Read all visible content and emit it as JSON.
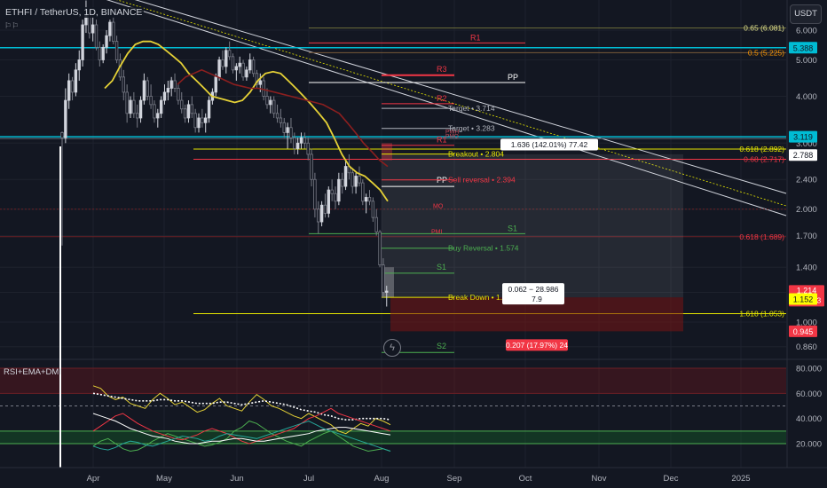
{
  "header": {
    "symbol_title": "ETHFI / TetherUS, 1D, BINANCE",
    "sub_icon": "flag-icon",
    "currency_button": "USDT",
    "indicator_label": "RSI+EMA+DMI"
  },
  "colors": {
    "background": "#131722",
    "grid": "#1e222d",
    "up": "#d1d4dc",
    "down": "#787b86",
    "ema": "#e5d136",
    "ema_red": "#8b1f1f",
    "cyan": "#00bcd4",
    "red": "#f23645",
    "green": "#4caf50",
    "yellow": "#e6e600",
    "white": "#ffffff",
    "orange": "#ff9800"
  },
  "chart_data": [
    {
      "type": "candlestick",
      "title": "ETHFI / TetherUS, 1D, BINANCE",
      "y_scale": "log",
      "ylim": [
        0.8,
        6.6
      ],
      "x_ticks": [
        "Apr",
        "May",
        "Jun",
        "Jul",
        "Aug",
        "Sep",
        "Oct",
        "Nov",
        "Dec",
        "2025"
      ],
      "y_ticks": [
        "6.000",
        "5.000",
        "4.000",
        "3.000",
        "2.400",
        "2.000",
        "1.700",
        "1.400",
        "1.200",
        "1.000",
        "0.860"
      ],
      "series": [
        {
          "name": "candles",
          "ohlc": [
            [
              3.2,
              3.22,
              1.6,
              3.1
            ],
            [
              3.1,
              4.2,
              3.0,
              3.9
            ],
            [
              3.9,
              4.6,
              3.7,
              4.4
            ],
            [
              4.4,
              4.5,
              3.9,
              4.1
            ],
            [
              4.1,
              4.9,
              4.0,
              4.7
            ],
            [
              4.7,
              5.3,
              4.4,
              5.0
            ],
            [
              5.0,
              6.4,
              4.8,
              6.2
            ],
            [
              6.2,
              7.2,
              5.9,
              6.6
            ],
            [
              6.6,
              6.8,
              5.7,
              5.9
            ],
            [
              5.9,
              6.5,
              5.6,
              6.2
            ],
            [
              6.2,
              6.4,
              5.3,
              5.4
            ],
            [
              5.4,
              5.6,
              4.8,
              5.0
            ],
            [
              5.0,
              5.5,
              4.9,
              5.4
            ],
            [
              5.4,
              6.0,
              5.2,
              5.8
            ],
            [
              5.8,
              6.4,
              5.6,
              6.3
            ],
            [
              6.3,
              6.5,
              5.5,
              5.6
            ],
            [
              5.6,
              5.8,
              4.9,
              5.0
            ],
            [
              5.0,
              5.2,
              4.4,
              4.5
            ],
            [
              4.5,
              4.7,
              3.9,
              4.1
            ],
            [
              4.1,
              4.3,
              3.4,
              3.6
            ],
            [
              3.6,
              4.0,
              3.5,
              3.9
            ],
            [
              3.9,
              4.1,
              3.5,
              3.6
            ],
            [
              3.6,
              3.8,
              3.3,
              3.5
            ],
            [
              3.5,
              4.0,
              3.4,
              3.9
            ],
            [
              3.9,
              4.6,
              3.8,
              4.4
            ],
            [
              4.4,
              4.5,
              3.9,
              4.0
            ],
            [
              4.0,
              4.3,
              3.7,
              3.8
            ],
            [
              3.8,
              3.9,
              3.4,
              3.5
            ],
            [
              3.5,
              3.7,
              3.3,
              3.6
            ],
            [
              3.6,
              4.0,
              3.5,
              3.9
            ],
            [
              3.9,
              4.3,
              3.8,
              4.1
            ],
            [
              4.1,
              4.4,
              3.9,
              4.2
            ],
            [
              4.2,
              4.5,
              4.0,
              4.4
            ],
            [
              4.4,
              4.6,
              4.1,
              4.2
            ],
            [
              4.2,
              4.3,
              3.8,
              3.9
            ],
            [
              3.9,
              4.1,
              3.6,
              3.7
            ],
            [
              3.7,
              3.8,
              3.4,
              3.5
            ],
            [
              3.5,
              3.9,
              3.4,
              3.8
            ],
            [
              3.8,
              4.0,
              3.5,
              3.6
            ],
            [
              3.6,
              3.7,
              3.2,
              3.3
            ],
            [
              3.3,
              3.6,
              3.2,
              3.5
            ],
            [
              3.5,
              3.7,
              3.3,
              3.4
            ],
            [
              3.4,
              3.6,
              3.2,
              3.5
            ],
            [
              3.5,
              4.0,
              3.4,
              3.9
            ],
            [
              3.9,
              4.2,
              3.8,
              4.1
            ],
            [
              4.1,
              4.6,
              4.0,
              4.5
            ],
            [
              4.5,
              5.1,
              4.4,
              5.0
            ],
            [
              5.0,
              5.3,
              4.7,
              4.8
            ],
            [
              4.8,
              5.4,
              4.6,
              5.3
            ],
            [
              5.3,
              5.6,
              5.0,
              5.1
            ],
            [
              5.1,
              5.2,
              4.6,
              4.7
            ],
            [
              4.7,
              4.9,
              4.4,
              4.8
            ],
            [
              4.8,
              5.1,
              4.6,
              4.9
            ],
            [
              4.9,
              5.0,
              4.4,
              4.5
            ],
            [
              4.5,
              4.8,
              4.4,
              4.7
            ],
            [
              4.7,
              5.2,
              4.6,
              5.0
            ],
            [
              5.0,
              5.1,
              4.5,
              4.6
            ],
            [
              4.6,
              4.7,
              4.2,
              4.3
            ],
            [
              4.3,
              4.6,
              4.1,
              4.4
            ],
            [
              4.4,
              4.5,
              3.9,
              4.0
            ],
            [
              4.0,
              4.2,
              3.7,
              3.8
            ],
            [
              3.8,
              4.0,
              3.6,
              3.9
            ],
            [
              3.9,
              4.0,
              3.5,
              3.6
            ],
            [
              3.6,
              3.8,
              3.4,
              3.5
            ],
            [
              3.5,
              3.7,
              3.3,
              3.4
            ],
            [
              3.4,
              3.5,
              3.1,
              3.2
            ],
            [
              3.2,
              3.4,
              2.9,
              3.3
            ],
            [
              3.3,
              3.5,
              3.0,
              3.1
            ],
            [
              3.1,
              3.2,
              2.8,
              2.9
            ],
            [
              2.9,
              3.1,
              2.8,
              3.0
            ],
            [
              3.0,
              3.2,
              2.9,
              3.1
            ],
            [
              3.1,
              3.2,
              2.9,
              3.0
            ],
            [
              3.0,
              3.1,
              2.7,
              2.8
            ],
            [
              2.8,
              2.9,
              2.3,
              2.4
            ],
            [
              2.4,
              2.5,
              1.9,
              2.0
            ],
            [
              2.0,
              2.1,
              1.72,
              1.85
            ],
            [
              1.85,
              2.1,
              1.8,
              2.05
            ],
            [
              2.05,
              2.2,
              1.9,
              1.95
            ],
            [
              1.95,
              2.3,
              1.9,
              2.25
            ],
            [
              2.25,
              2.4,
              2.1,
              2.2
            ],
            [
              2.2,
              2.3,
              2.0,
              2.1
            ],
            [
              2.1,
              2.5,
              2.05,
              2.4
            ],
            [
              2.4,
              2.5,
              2.2,
              2.3
            ],
            [
              2.3,
              2.7,
              2.25,
              2.6
            ],
            [
              2.6,
              2.8,
              2.4,
              2.5
            ],
            [
              2.5,
              2.55,
              2.2,
              2.3
            ],
            [
              2.3,
              2.5,
              2.2,
              2.45
            ],
            [
              2.45,
              2.6,
              2.3,
              2.35
            ],
            [
              2.35,
              2.4,
              2.05,
              2.1
            ],
            [
              2.1,
              2.2,
              1.95,
              2.15
            ],
            [
              2.15,
              2.25,
              2.05,
              2.1
            ],
            [
              2.1,
              2.15,
              1.85,
              1.9
            ],
            [
              1.9,
              2.0,
              1.7,
              1.74
            ],
            [
              1.74,
              1.76,
              1.4,
              1.42
            ],
            [
              1.42,
              1.48,
              1.16,
              1.2
            ],
            [
              1.2,
              1.25,
              1.1,
              1.21
            ]
          ]
        },
        {
          "name": "EMA",
          "values": [
            4.2,
            4.4,
            4.8,
            5.2,
            5.5,
            5.6,
            5.6,
            5.5,
            5.3,
            5.1,
            4.9,
            4.6,
            4.4,
            4.2,
            4.0,
            3.95,
            3.9,
            3.85,
            3.9,
            4.1,
            4.4,
            4.6,
            4.65,
            4.6,
            4.4,
            4.2,
            4.0,
            3.8,
            3.6,
            3.4,
            3.1,
            2.8,
            2.6,
            2.5,
            2.45,
            2.35,
            2.25,
            2.1
          ]
        },
        {
          "name": "EMA slow",
          "values": [
            4.3,
            4.5,
            4.6,
            4.7,
            4.6,
            4.5,
            4.4,
            4.3,
            4.25,
            4.2,
            4.2,
            4.15,
            4.1,
            4.05,
            4.0,
            3.95,
            3.9,
            3.85,
            3.8,
            3.7,
            3.6,
            3.4,
            3.2,
            3.0,
            2.85,
            2.7,
            2.6
          ]
        }
      ],
      "levels": {
        "fib_065": {
          "label": "0.65 (6.081)",
          "value": 6.081
        },
        "fib_05": {
          "label": "0.5 (5.225)",
          "value": 5.225
        },
        "fib_0618_top": {
          "label": "0.618 (2.892)",
          "value": 2.892
        },
        "fib_068": {
          "label": "0.68 (2.717)",
          "value": 2.717
        },
        "fib_0618_mid": {
          "label": "0.618 (1.689)",
          "value": 1.689
        },
        "fib_1618": {
          "label": "1.618 (1.053)",
          "value": 1.053
        },
        "cyan_top": {
          "value": 5.388
        },
        "cyan_mid": {
          "value": 3.119
        }
      },
      "pivots": {
        "r1_top": "R1",
        "r3": "R3",
        "pp_top": "PP",
        "r2": "R2",
        "r1_mid": "R1",
        "pp_mid": "PP",
        "mo": "MO",
        "pml": "PML",
        "s1_a": "S1",
        "s1_b": "S1",
        "s2": "S2",
        "pwh": "PWH",
        "pmo": "PMO"
      },
      "annotations": {
        "target1": "Target • 3.714",
        "target2": "Target • 3.283",
        "breakout": "Breakout • 2.804",
        "sell_reversal": "Sell reversal • 2.394",
        "buy_reversal": "Buy Reversal • 1.574",
        "break_down": "Break Down • 1.164",
        "measure_up": "1.636 (142.01%) 77.42",
        "measure_small": "0.062 − 28.986",
        "measure_small2": "7.9",
        "measure_down": "0.207 (17.97%) 24"
      },
      "price_tags": {
        "cyan_top": "5.388",
        "cyan_mid": "3.119",
        "level_white": "2.788",
        "current": "1.214",
        "countdown": "20:11:03",
        "yellow": "1.152",
        "red": "0.945"
      }
    },
    {
      "type": "line",
      "title": "RSI+EMA+DMI",
      "ylim": [
        10,
        85
      ],
      "y_ticks": [
        "80.000",
        "60.000",
        "40.000",
        "20.000"
      ],
      "series": [
        {
          "name": "RSI",
          "values": [
            66,
            64,
            58,
            55,
            57,
            52,
            50,
            48,
            55,
            60,
            56,
            51,
            53,
            49,
            45,
            47,
            52,
            56,
            50,
            48,
            46,
            53,
            59,
            55,
            50,
            48,
            45,
            42,
            40,
            44,
            41,
            38,
            35,
            30,
            28,
            32,
            36,
            34,
            40,
            38,
            35
          ]
        },
        {
          "name": "RSI EMA",
          "values": [
            60,
            59,
            58,
            57,
            56,
            55,
            54,
            54,
            54,
            55,
            55,
            54,
            54,
            53,
            52,
            52,
            52,
            53,
            53,
            52,
            51,
            52,
            53,
            54,
            53,
            52,
            51,
            49,
            47,
            46,
            45,
            43,
            42,
            40,
            39,
            39,
            40,
            40,
            40,
            40,
            39
          ]
        },
        {
          "name": "+DI",
          "values": [
            18,
            22,
            24,
            20,
            16,
            14,
            15,
            18,
            22,
            25,
            28,
            26,
            24,
            22,
            20,
            18,
            19,
            21,
            24,
            30,
            33,
            38,
            36,
            32,
            28,
            25,
            22,
            20,
            18,
            22,
            25,
            28,
            30,
            26,
            22,
            18,
            16,
            14,
            15,
            16,
            14
          ]
        },
        {
          "name": "-DI",
          "values": [
            30,
            34,
            38,
            42,
            44,
            40,
            36,
            33,
            30,
            28,
            26,
            24,
            23,
            25,
            27,
            30,
            32,
            30,
            28,
            25,
            22,
            20,
            22,
            24,
            26,
            28,
            30,
            32,
            36,
            40,
            42,
            45,
            48,
            44,
            42,
            40,
            38,
            36,
            34,
            32,
            30
          ]
        },
        {
          "name": "ADX",
          "values": [
            44,
            42,
            40,
            38,
            35,
            32,
            30,
            28,
            26,
            25,
            24,
            22,
            21,
            20,
            20,
            21,
            22,
            22,
            23,
            24,
            24,
            23,
            22,
            22,
            23,
            24,
            25,
            26,
            27,
            28,
            30,
            31,
            32,
            33,
            33,
            32,
            31,
            30,
            29,
            28,
            27
          ]
        },
        {
          "name": "DMI",
          "values": [
            18,
            16,
            15,
            17,
            20,
            22,
            21,
            19,
            18,
            20,
            22,
            24,
            26,
            25,
            24,
            22,
            23,
            26,
            28,
            27,
            26,
            25,
            24,
            26,
            28,
            30,
            32,
            34,
            36,
            38,
            35,
            32,
            30,
            28,
            26,
            24,
            22,
            20,
            18,
            16,
            14
          ]
        }
      ]
    }
  ]
}
